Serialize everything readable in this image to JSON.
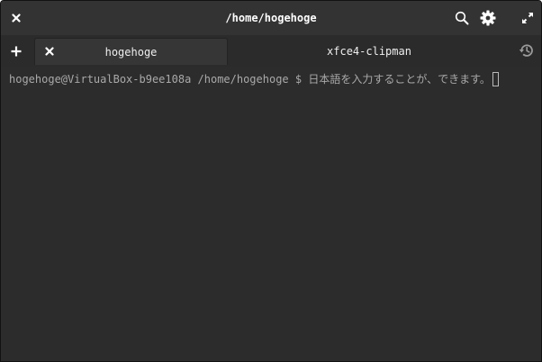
{
  "window": {
    "title": "/home/hogehoge"
  },
  "header": {
    "close_icon": "close-icon",
    "search_icon": "search-icon",
    "settings_icon": "gear-icon",
    "fullscreen_icon": "fullscreen-icon"
  },
  "tabs": [
    {
      "label": "hogehoge",
      "active": true
    },
    {
      "label": "xfce4-clipman",
      "active": false
    }
  ],
  "tabbar": {
    "new_tab_icon": "plus-icon",
    "history_icon": "history-icon"
  },
  "terminal": {
    "prompt": "hogehoge@VirtualBox-b9ee108a /home/hogehoge $ ",
    "input": "日本語を入力することが、できます。"
  },
  "colors": {
    "background": "#2c2c2c",
    "titlebar": "#333333",
    "active_tab": "#363636",
    "text": "#a9a9a9"
  }
}
